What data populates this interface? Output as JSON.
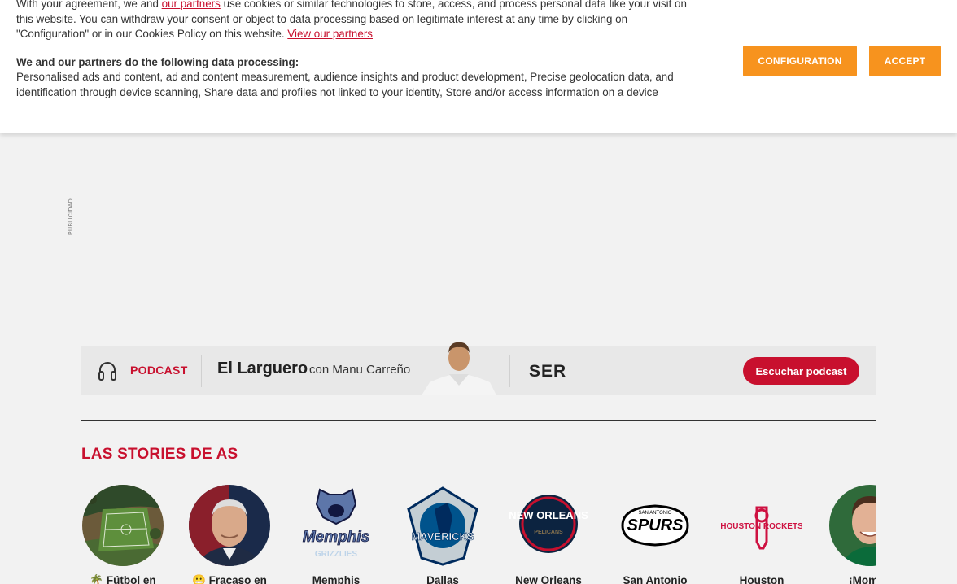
{
  "cookie": {
    "line1_pre": "With your agreement, we and ",
    "partners_link": "our partners",
    "line1_post": " use cookies or similar technologies to store, access, and process personal data like your visit on this website. You can withdraw your consent or object to data processing based on legitimate interest at any time by clicking on \"Configuration\" or in our Cookies Policy on this website. ",
    "view_partners": "View our partners",
    "processing_heading": "We and our partners do the following data processing:",
    "processing_text": "Personalised ads and content, ad and content measurement, audience insights and product development, Precise geolocation data, and identification through device scanning, Share data and profiles not linked to your identity, Store and/or access information on a device",
    "config_button": "CONFIGURATION",
    "accept_button": "ACCEPT",
    "accent_color": "#f7931e"
  },
  "ad": {
    "label": "PUBLICIDAD"
  },
  "podcast": {
    "label": "PODCAST",
    "show_title": "El Larguero",
    "host": "con Manu Carreño",
    "network": "SER",
    "listen_button": "Escuchar podcast",
    "accent_color": "#c8102e"
  },
  "stories": {
    "title": "LAS STORIES DE AS",
    "items": [
      {
        "label": "🌴 Fútbol en",
        "icon": "football-pitch-image"
      },
      {
        "label": "😬 Fracaso en",
        "icon": "person-photo"
      },
      {
        "label": "Memphis",
        "icon": "memphis-grizzlies-logo"
      },
      {
        "label": "Dallas",
        "icon": "dallas-mavericks-logo"
      },
      {
        "label": "New Orleans",
        "icon": "new-orleans-pelicans-logo"
      },
      {
        "label": "San Antonio",
        "icon": "san-antonio-spurs-logo"
      },
      {
        "label": "Houston",
        "icon": "houston-rockets-logo"
      },
      {
        "label": "¡Momen",
        "icon": "player-photo"
      }
    ]
  }
}
